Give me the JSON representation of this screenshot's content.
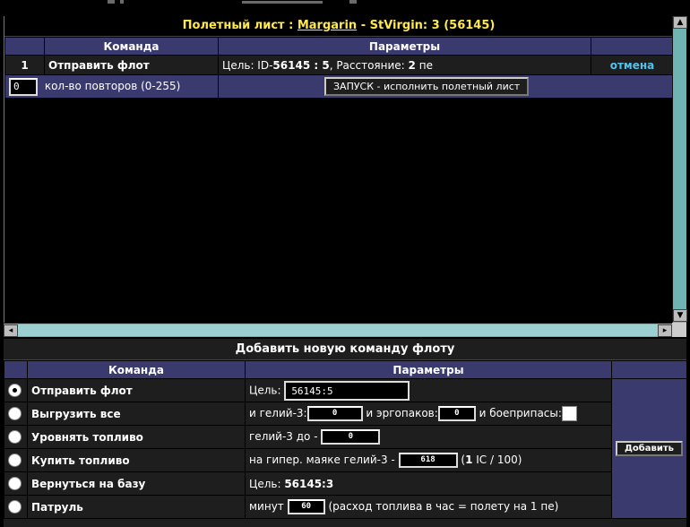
{
  "sheet": {
    "title_prefix": "Полетный лист : ",
    "player": "Margarin",
    "title_sep": " - ",
    "planet": "StVirgin: 3 (56145)",
    "col_command": "Команда",
    "col_params": "Параметры",
    "rows": [
      {
        "num": "1",
        "command": "Отправить флот",
        "param_target_label": "Цель: ID-",
        "param_target_value": "56145 : 5",
        "param_dist_label": ", Расстояние: ",
        "param_dist_value": "2",
        "param_dist_unit": " пе",
        "action": "отмена"
      }
    ],
    "repeat_value": "0",
    "repeat_label": "кол-во повторов (0-255)",
    "launch_label": "ЗАПУСК - исполнить полетный лист"
  },
  "panel": {
    "title": "Добавить новую команду флоту",
    "col_command": "Команда",
    "col_params": "Параметры",
    "add_label": "Добавить",
    "commands": {
      "send": {
        "label": "Отправить флот",
        "target_label": "Цель:",
        "target_value": "56145:5",
        "selected": true
      },
      "unload": {
        "label": "Выгрузить все",
        "he_label": "и гелий-3:",
        "he_value": "0",
        "ergo_label": "и эргопаков:",
        "ergo_value": "0",
        "ammo_label": "и боеприпасы:"
      },
      "level": {
        "label": "Уровнять топливо",
        "he_label": "гелий-3 до -",
        "he_value": "0"
      },
      "buy": {
        "label": "Купить топливо",
        "text": "на гипер. маяке гелий-3 -",
        "value": "618",
        "price_open": "(",
        "price_num": "1",
        "price_rest": " IC / 100)"
      },
      "base": {
        "label": "Вернуться на базу",
        "target_label": "Цель:",
        "target_value": "56145:3"
      },
      "patrol": {
        "label": "Патруль",
        "minutes_label": "минут",
        "minutes_value": "60",
        "note": "(расход топлива в час = полету на 1 пе)"
      }
    }
  }
}
